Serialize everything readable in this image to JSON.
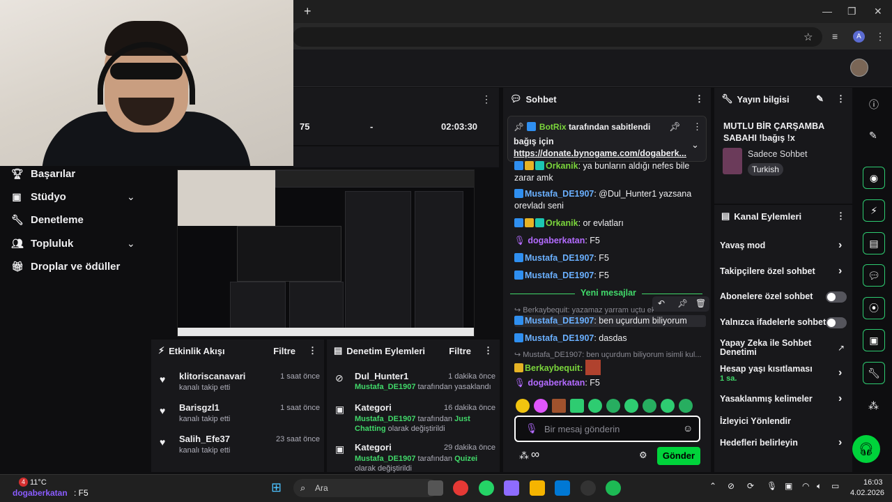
{
  "browser": {
    "new_tab": "+",
    "avatar_letter": "A"
  },
  "sidebar": {
    "items": [
      {
        "label": "Başarılar",
        "icon": "trophy-icon"
      },
      {
        "label": "Stüdyo",
        "icon": "studio-icon",
        "expandable": true
      },
      {
        "label": "Denetleme",
        "icon": "wrench-icon"
      },
      {
        "label": "Topluluk",
        "icon": "community-icon",
        "expandable": true
      },
      {
        "label": "Droplar ve ödüller",
        "icon": "gift-icon"
      }
    ]
  },
  "stats": {
    "viewers": "75",
    "followers": "-",
    "uptime": "02:03:30"
  },
  "activity": {
    "title": "Etkinlik Akışı",
    "filter": "Filtre",
    "items": [
      {
        "name": "klitoriscanavari",
        "sub": "kanalı takip etti",
        "time": "1 saat önce"
      },
      {
        "name": "Barisgzl1",
        "sub": "kanalı takip etti",
        "time": "1 saat önce"
      },
      {
        "name": "Salih_Efe37",
        "sub": "kanalı takip etti",
        "time": "23 saat önce"
      }
    ]
  },
  "moderation": {
    "title": "Denetim Eylemleri",
    "filter": "Filtre",
    "items": [
      {
        "name": "Dul_Hunter1",
        "time": "1 dakika önce",
        "actor": "Mustafa_DE1907",
        "desc": "tarafından yasaklandı"
      },
      {
        "name": "Kategori",
        "time": "16 dakika önce",
        "actor": "Mustafa_DE1907",
        "desc": "tarafından",
        "target": "Just Chatting",
        "desc2": "olarak değiştirildi"
      },
      {
        "name": "Kategori",
        "time": "29 dakika önce",
        "actor": "Mustafa_DE1907",
        "desc": "tarafından",
        "target": "Quizei",
        "desc2": "olarak değiştirildi"
      }
    ]
  },
  "chat": {
    "title": "Sohbet",
    "pinned": {
      "by": "BotRix",
      "by_suffix": "tarafından sabitlendi",
      "text": "bağış için",
      "link": "https://donate.bynogame.com/dogaberk..."
    },
    "messages": [
      {
        "user": "Orkanik",
        "text": ": ya bunların aldığı nefes bile zarar amk",
        "color": "green"
      },
      {
        "user": "Mustafa_DE1907",
        "text": ": @Dul_Hunter1 yazsana orevladı seni",
        "color": "blue"
      },
      {
        "user": "Orkanik",
        "text": ": or evlatları",
        "color": "green"
      },
      {
        "user": "dogaberkatan",
        "text": ": F5",
        "color": "purple"
      },
      {
        "user": "Mustafa_DE1907",
        "text": ": F5",
        "color": "blue"
      },
      {
        "user": "Mustafa_DE1907",
        "text": ": F5",
        "color": "blue"
      }
    ],
    "new_messages": "Yeni mesajlar",
    "reply1": "Berkaybequit: yazamaz yarram uçtu ek...",
    "msg_after": [
      {
        "user": "Mustafa_DE1907",
        "text": ": ben uçurdum biliyorum",
        "color": "blue"
      },
      {
        "user": "Mustafa_DE1907",
        "text": ": dasdas",
        "color": "blue"
      }
    ],
    "reply2": "Mustafa_DE1907: ben uçurdum biliyorum isimli kul...",
    "berkay": "Berkaybequit:",
    "last": {
      "user": "dogaberkatan",
      "text": ": F5"
    },
    "input_placeholder": "Bir mesaj gönderin",
    "send": "Gönder",
    "infinity": "∞"
  },
  "stream_info": {
    "title": "Yayın bilgisi",
    "stream_title": "MUTLU BİR ÇARŞAMBA SABAHI !bağış !x",
    "category": "Sadece Sohbet",
    "tag": "Turkish"
  },
  "channel_actions": {
    "title": "Kanal Eylemleri",
    "items": [
      {
        "label": "Yavaş mod",
        "kind": "chevron"
      },
      {
        "label": "Takipçilere özel sohbet",
        "kind": "chevron"
      },
      {
        "label": "Abonelere özel sohbet",
        "kind": "toggle"
      },
      {
        "label": "Yalnızca ifadelerle sohbet",
        "kind": "toggle"
      },
      {
        "label": "Yapay Zeka ile Sohbet Denetimi",
        "kind": "external"
      },
      {
        "label": "Hesap yaşı kısıtlaması",
        "kind": "chevron",
        "sub": "1 sa."
      },
      {
        "label": "Yasaklanmış kelimeler",
        "kind": "chevron"
      },
      {
        "label": "İzleyici Yönlendir",
        "kind": "none"
      },
      {
        "label": "Hedefleri belirleyin",
        "kind": "chevron"
      }
    ]
  },
  "taskbar": {
    "notif_badge": "4",
    "temp": "11°C",
    "overlay_user": "dogaberkatan",
    "overlay_text": ": F5",
    "search": "Ara",
    "time": "16:03",
    "date": "4.02.2026"
  }
}
